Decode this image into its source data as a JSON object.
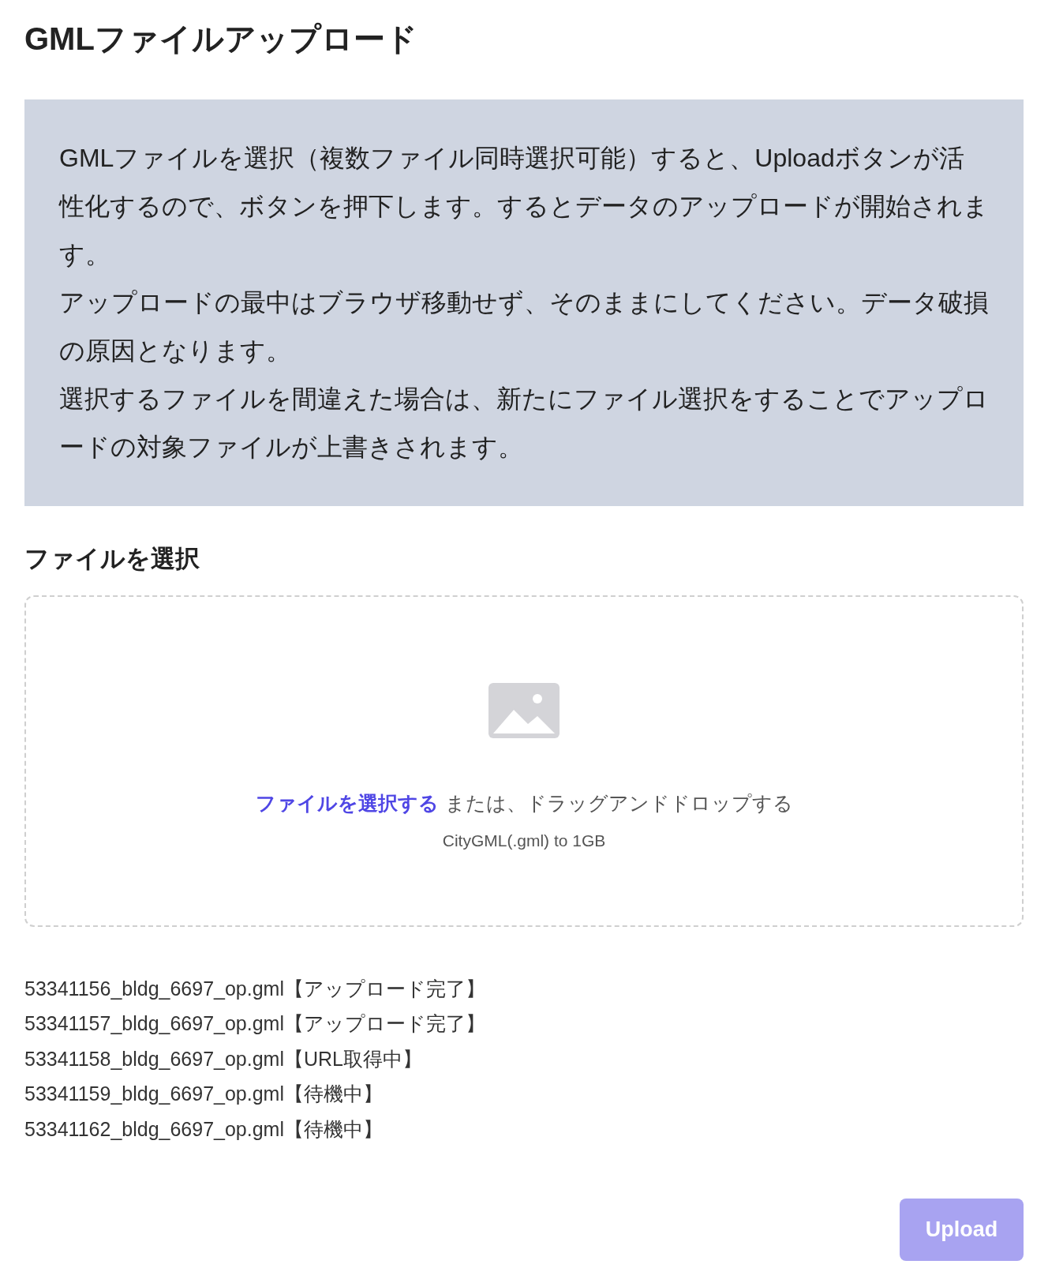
{
  "title": "GMLファイルアップロード",
  "notice": [
    "GMLファイルを選択（複数ファイル同時選択可能）すると、Uploadボタンが活性化するので、ボタンを押下します。するとデータのアップロードが開始されます。",
    "アップロードの最中はブラウザ移動せず、そのままにしてください。データ破損の原因となります。",
    "選択するファイルを間違えた場合は、新たにファイル選択をすることでアップロードの対象ファイルが上書きされます。"
  ],
  "file_select": {
    "heading": "ファイルを選択",
    "link": "ファイルを選択する",
    "instruction": "または、ドラッグアンドドロップする",
    "hint": "CityGML(.gml) to 1GB"
  },
  "files": [
    {
      "name": "53341156_bldg_6697_op.gml",
      "status": "【アップロード完了】"
    },
    {
      "name": "53341157_bldg_6697_op.gml",
      "status": "【アップロード完了】"
    },
    {
      "name": "53341158_bldg_6697_op.gml",
      "status": "【URL取得中】"
    },
    {
      "name": "53341159_bldg_6697_op.gml",
      "status": "【待機中】"
    },
    {
      "name": "53341162_bldg_6697_op.gml",
      "status": "【待機中】"
    }
  ],
  "upload_button": {
    "label": "Upload",
    "disabled": true
  }
}
